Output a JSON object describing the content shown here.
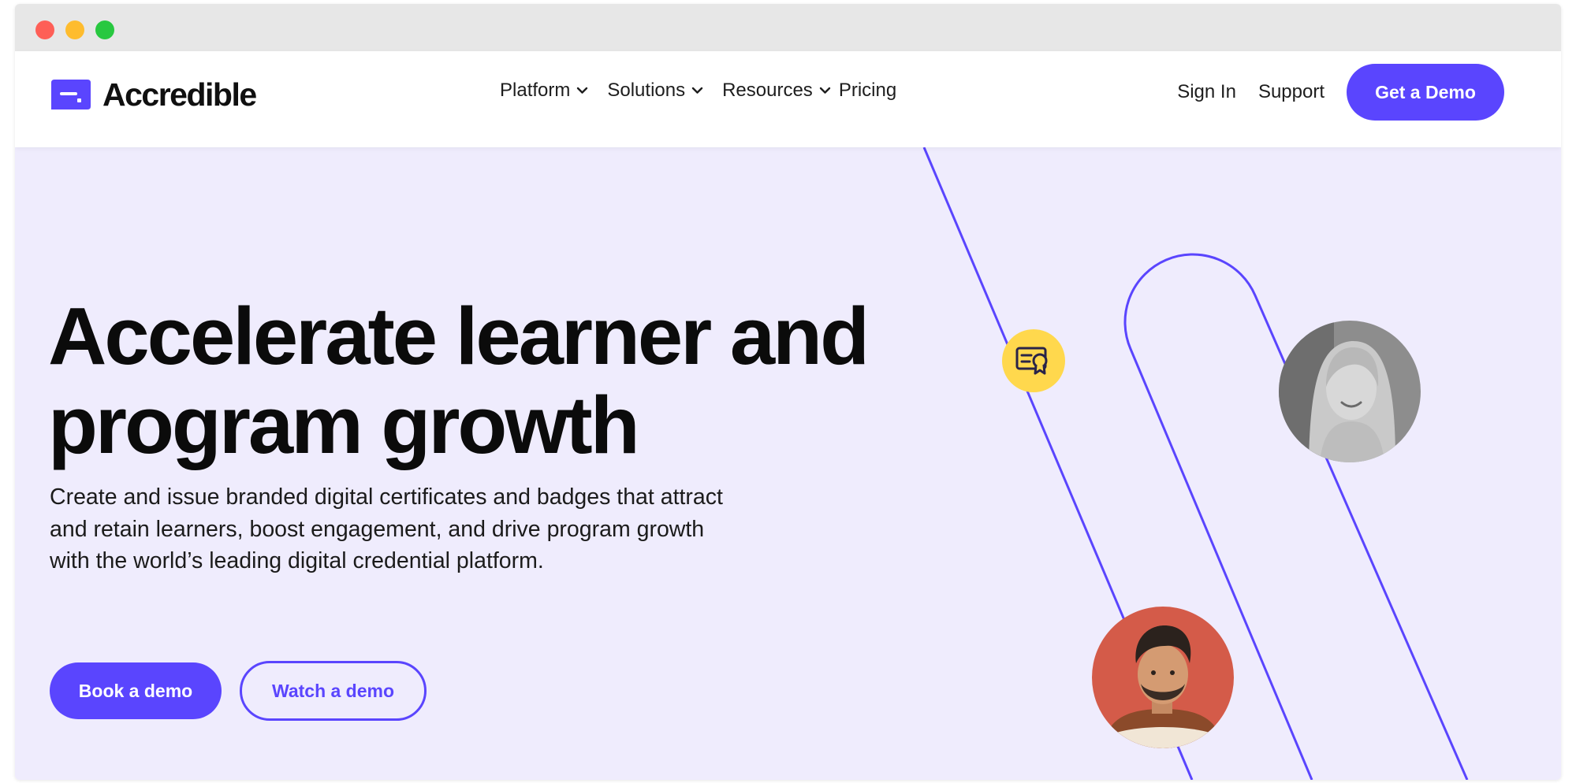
{
  "brand": {
    "name": "Accredible",
    "accent_color": "#5a45fe",
    "hero_background": "#efecfd",
    "badge_color": "#ffd84d"
  },
  "nav": {
    "items": [
      {
        "label": "Platform",
        "icon": "chevron-down-icon"
      },
      {
        "label": "Solutions",
        "icon": "chevron-down-icon"
      },
      {
        "label": "Resources",
        "icon": "chevron-down-icon"
      },
      {
        "label": "Pricing"
      }
    ],
    "sign_in": "Sign In",
    "support": "Support",
    "cta": "Get a Demo"
  },
  "hero": {
    "title_line1": "Accelerate learner and",
    "title_line2": "program growth",
    "description": "Create and issue branded digital certificates and badges that attract and retain learners, boost engagement, and drive program growth with the world’s leading digital credential platform.",
    "primary_button": "Book a demo",
    "secondary_button": "Watch a demo",
    "decor": {
      "badge_icon": "certificate-icon",
      "avatar_1": "woman-portrait",
      "avatar_2": "man-portrait"
    }
  }
}
